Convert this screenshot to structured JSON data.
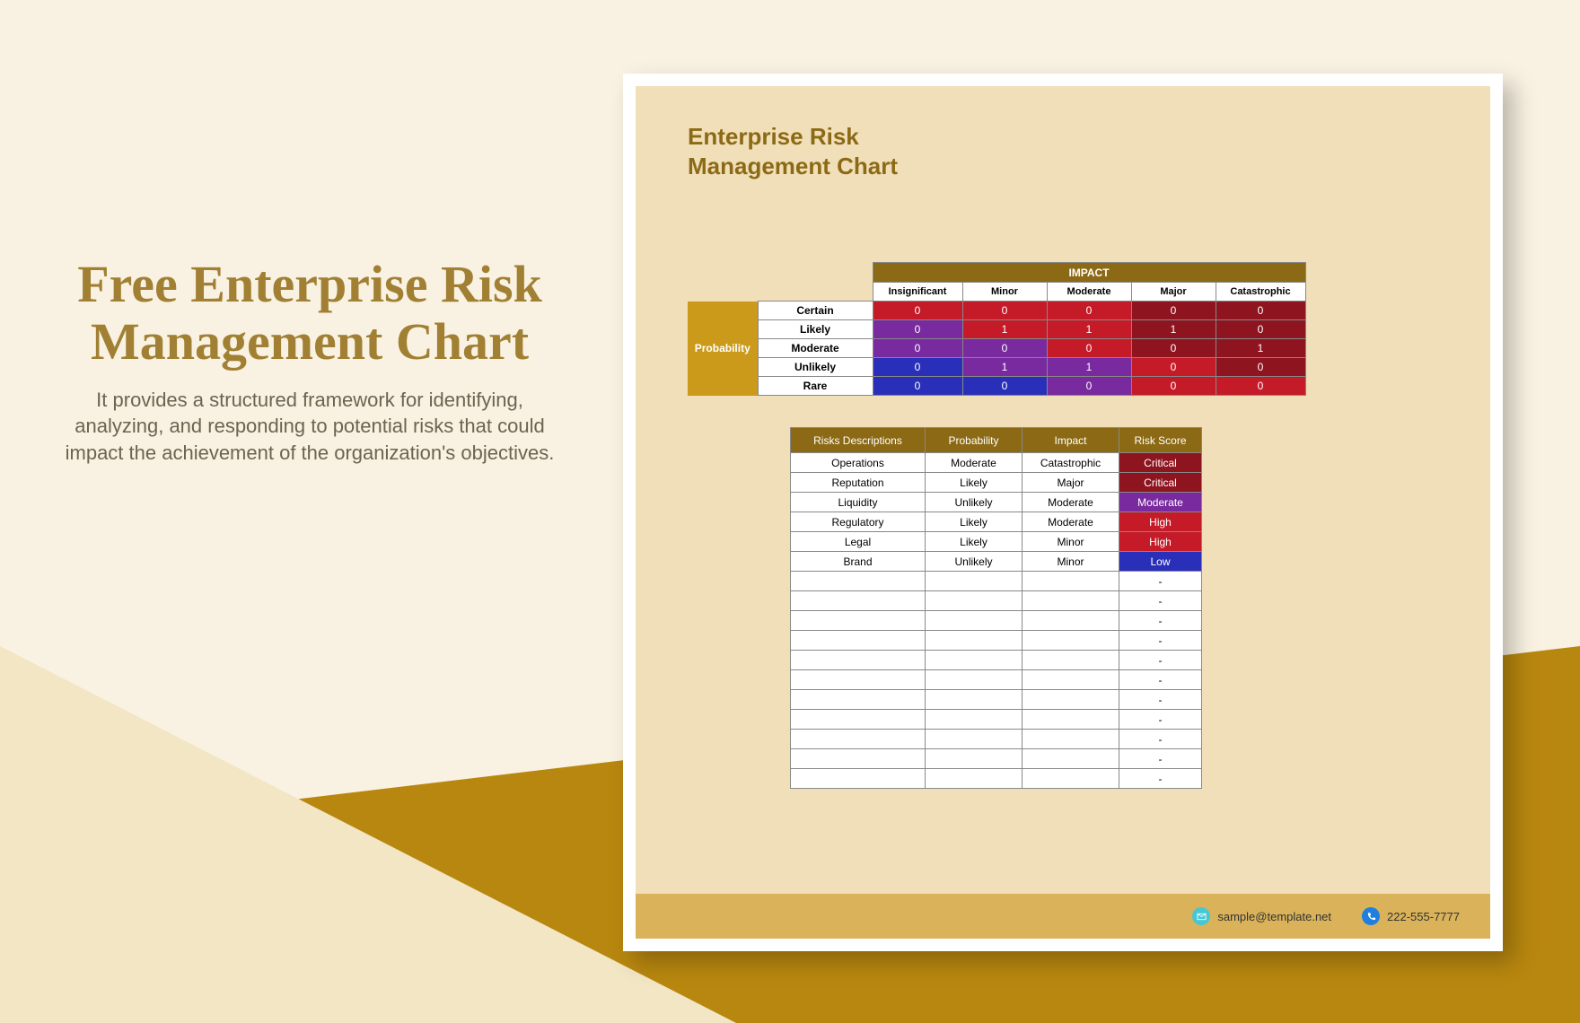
{
  "left": {
    "title": "Free Enterprise Risk Management Chart",
    "subtitle": "It provides a structured framework for identifying, analyzing, and responding to potential risks that could impact the achievement of the organization's objectives."
  },
  "doc": {
    "title_line1": "Enterprise Risk",
    "title_line2": "Management Chart"
  },
  "matrix": {
    "impact_header": "IMPACT",
    "probability_header": "Probability",
    "impact_labels": [
      "Insignificant",
      "Minor",
      "Moderate",
      "Major",
      "Catastrophic"
    ],
    "rows": [
      {
        "name": "Certain",
        "cells": [
          {
            "v": "0",
            "c": "c-red"
          },
          {
            "v": "0",
            "c": "c-red"
          },
          {
            "v": "0",
            "c": "c-red"
          },
          {
            "v": "0",
            "c": "c-dred"
          },
          {
            "v": "0",
            "c": "c-dred"
          }
        ]
      },
      {
        "name": "Likely",
        "cells": [
          {
            "v": "0",
            "c": "c-purple"
          },
          {
            "v": "1",
            "c": "c-red"
          },
          {
            "v": "1",
            "c": "c-red"
          },
          {
            "v": "1",
            "c": "c-dred"
          },
          {
            "v": "0",
            "c": "c-dred"
          }
        ]
      },
      {
        "name": "Moderate",
        "cells": [
          {
            "v": "0",
            "c": "c-purple"
          },
          {
            "v": "0",
            "c": "c-purple"
          },
          {
            "v": "0",
            "c": "c-red"
          },
          {
            "v": "0",
            "c": "c-dred"
          },
          {
            "v": "1",
            "c": "c-dred"
          }
        ]
      },
      {
        "name": "Unlikely",
        "cells": [
          {
            "v": "0",
            "c": "c-blue"
          },
          {
            "v": "1",
            "c": "c-purple"
          },
          {
            "v": "1",
            "c": "c-purple"
          },
          {
            "v": "0",
            "c": "c-red"
          },
          {
            "v": "0",
            "c": "c-dred"
          }
        ]
      },
      {
        "name": "Rare",
        "cells": [
          {
            "v": "0",
            "c": "c-blue"
          },
          {
            "v": "0",
            "c": "c-blue"
          },
          {
            "v": "0",
            "c": "c-purple"
          },
          {
            "v": "0",
            "c": "c-red"
          },
          {
            "v": "0",
            "c": "c-red"
          }
        ]
      }
    ]
  },
  "risks": {
    "headers": [
      "Risks Descriptions",
      "Probability",
      "Impact",
      "Risk Score"
    ],
    "rows": [
      {
        "desc": "Operations",
        "prob": "Moderate",
        "imp": "Catastrophic",
        "score": "Critical",
        "score_class": "score-critical"
      },
      {
        "desc": "Reputation",
        "prob": "Likely",
        "imp": "Major",
        "score": "Critical",
        "score_class": "score-critical"
      },
      {
        "desc": "Liquidity",
        "prob": "Unlikely",
        "imp": "Moderate",
        "score": "Moderate",
        "score_class": "score-moderate"
      },
      {
        "desc": "Regulatory",
        "prob": "Likely",
        "imp": "Moderate",
        "score": "High",
        "score_class": "score-high"
      },
      {
        "desc": "Legal",
        "prob": "Likely",
        "imp": "Minor",
        "score": "High",
        "score_class": "score-high"
      },
      {
        "desc": "Brand",
        "prob": "Unlikely",
        "imp": "Minor",
        "score": "Low",
        "score_class": "score-low"
      }
    ],
    "empty_rows": 11,
    "empty_score": "-"
  },
  "footer": {
    "email": "sample@template.net",
    "phone": "222-555-7777"
  },
  "chart_data": {
    "type": "table",
    "title": "Enterprise Risk Management Chart",
    "impact_matrix": {
      "columns": [
        "Insignificant",
        "Minor",
        "Moderate",
        "Major",
        "Catastrophic"
      ],
      "rows": [
        "Certain",
        "Likely",
        "Moderate",
        "Unlikely",
        "Rare"
      ],
      "values": [
        [
          0,
          0,
          0,
          0,
          0
        ],
        [
          0,
          1,
          1,
          1,
          0
        ],
        [
          0,
          0,
          0,
          0,
          1
        ],
        [
          0,
          1,
          1,
          0,
          0
        ],
        [
          0,
          0,
          0,
          0,
          0
        ]
      ]
    },
    "risk_register": [
      {
        "description": "Operations",
        "probability": "Moderate",
        "impact": "Catastrophic",
        "risk_score": "Critical"
      },
      {
        "description": "Reputation",
        "probability": "Likely",
        "impact": "Major",
        "risk_score": "Critical"
      },
      {
        "description": "Liquidity",
        "probability": "Unlikely",
        "impact": "Moderate",
        "risk_score": "Moderate"
      },
      {
        "description": "Regulatory",
        "probability": "Likely",
        "impact": "Moderate",
        "risk_score": "High"
      },
      {
        "description": "Legal",
        "probability": "Likely",
        "impact": "Minor",
        "risk_score": "High"
      },
      {
        "description": "Brand",
        "probability": "Unlikely",
        "impact": "Minor",
        "risk_score": "Low"
      }
    ]
  }
}
